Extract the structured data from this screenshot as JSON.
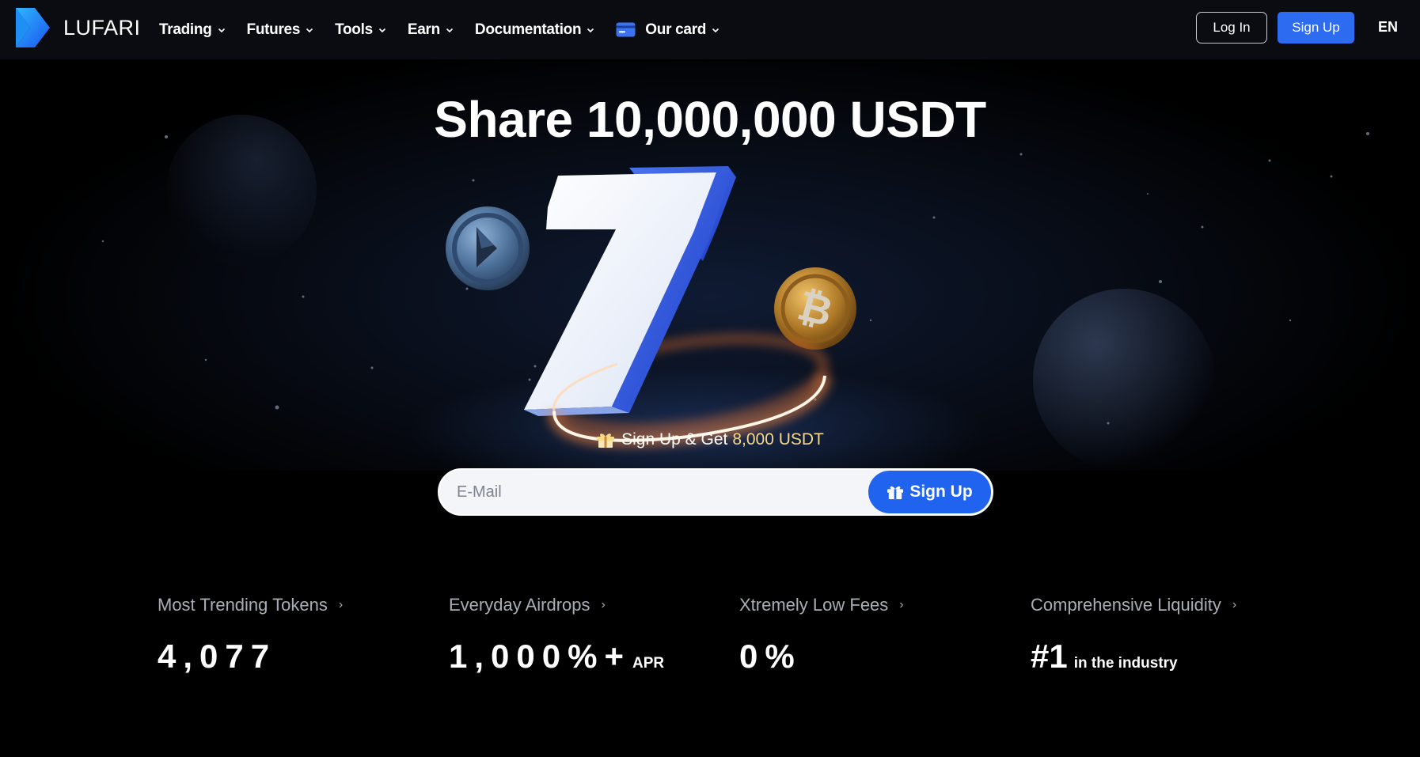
{
  "brand": {
    "name": "LUFARI"
  },
  "nav": {
    "items": [
      {
        "label": "Trading"
      },
      {
        "label": "Futures"
      },
      {
        "label": "Tools"
      },
      {
        "label": "Earn"
      },
      {
        "label": "Documentation"
      },
      {
        "label": "Our card",
        "icon": "card-icon"
      }
    ],
    "login_label": "Log In",
    "signup_label": "Sign Up",
    "language": "EN"
  },
  "hero": {
    "headline": "Share 10,000,000 USDT",
    "promo_text": "Sign Up & Get",
    "promo_amount": "8,000 USDT",
    "art_glyph": "7"
  },
  "form": {
    "email_placeholder": "E-Mail",
    "email_value": "",
    "signup_label": "Sign Up"
  },
  "stats": [
    {
      "label": "Most Trending Tokens",
      "value": "4,077",
      "suffix": ""
    },
    {
      "label": "Everyday Airdrops",
      "value": "1,000%+",
      "suffix": "APR"
    },
    {
      "label": "Xtremely Low Fees",
      "value": "0%",
      "suffix": ""
    },
    {
      "label": "Comprehensive Liquidity",
      "value": "#1",
      "suffix": "in the industry"
    }
  ],
  "colors": {
    "accent": "#2d6bf0",
    "background": "#000000",
    "nav_background": "#0a0c12",
    "promo_gold": "#f7d98a"
  }
}
